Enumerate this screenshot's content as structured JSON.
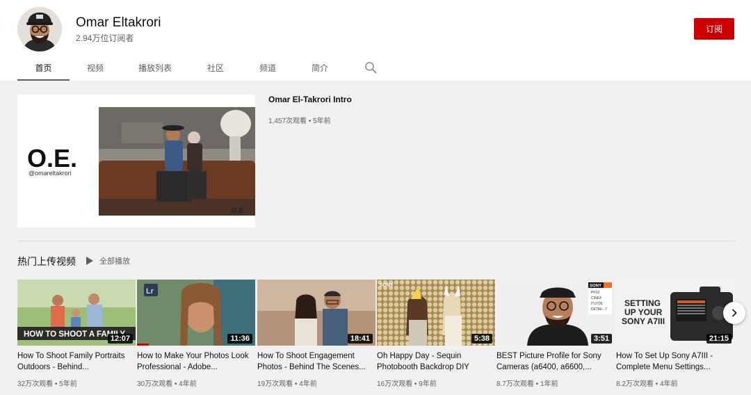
{
  "channel": {
    "name": "Omar Eltakrori",
    "subscribers": "2.94万位订阅者",
    "subscribe_label": "订阅"
  },
  "tabs": [
    {
      "label": "首页",
      "active": true
    },
    {
      "label": "视频",
      "active": false
    },
    {
      "label": "播放列表",
      "active": false
    },
    {
      "label": "社区",
      "active": false
    },
    {
      "label": "频道",
      "active": false
    },
    {
      "label": "简介",
      "active": false
    }
  ],
  "featured": {
    "title": "Omar El-Takrori Intro",
    "meta": "1,457次观看 • 5年前",
    "logo_text": "O.E.",
    "handle_text": "@omareltakrori",
    "watermark_text": "O.E."
  },
  "section": {
    "title": "热门上传视频",
    "play_all_label": "全部播放"
  },
  "videos": [
    {
      "title": "How To Shoot Family Portraits Outdoors - Behind...",
      "meta": "32万次观看 • 5年前",
      "duration": "12:07",
      "overlay_text": "HOW TO SHOOT A FAMILY"
    },
    {
      "title": "How to Make Your Photos Look Professional - Adobe...",
      "meta": "30万次观看 • 4年前",
      "duration": "11:36",
      "badge_text": "Lr",
      "progress": 0.1
    },
    {
      "title": "How To Shoot Engagement Photos - Behind The Scenes...",
      "meta": "19万次观看 • 4年前",
      "duration": "18:41"
    },
    {
      "title": "Oh Happy Day - Sequin Photobooth Backdrop DIY",
      "meta": "16万次观看 • 9年前",
      "duration": "5:38",
      "brand_text": "SONY"
    },
    {
      "title": "BEST Picture Profile for Sony Cameras (a6400, a6600,...",
      "meta": "8.7万次观看 • 1年前",
      "duration": "3:51",
      "sony_text": "SONY",
      "settings_lines": [
        "PP10",
        "CINE4",
        "ITU709",
        "DETAIL -7"
      ]
    },
    {
      "title": "How To Set Up Sony A7III - Complete Menu Settings...",
      "meta": "8.2万次观看 • 4年前",
      "duration": "21:15",
      "overlay_lines": [
        "SETTING",
        "UP YOUR",
        "SONY A7III"
      ]
    }
  ],
  "colors": {
    "subscribe": "#cc0000",
    "background": "#f1f1f1",
    "header": "#ffffff"
  },
  "icons": {
    "search": "search-icon",
    "play": "play-icon",
    "next": "chevron-right-icon"
  }
}
